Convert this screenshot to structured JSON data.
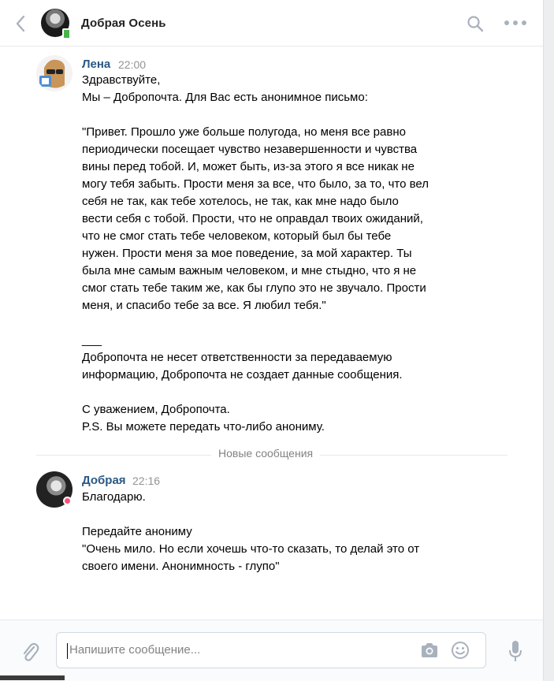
{
  "header": {
    "title": "Добрая Осень"
  },
  "messages": [
    {
      "author": "Лена",
      "time": "22:00",
      "text": "Здравствуйте,\nМы – Добропочта. Для Вас есть анонимное письмо:\n\n\"Привет. Прошло уже больше полугода, но меня все равно\nпериодически посещает чувство незавершенности и чувства\nвины перед тобой. И, может быть, из-за этого я все никак не\nмогу тебя забыть. Прости меня за все, что было, за то, что вел\nсебя не так, как тебе хотелось, не так, как мне надо было\nвести себя с тобой. Прости, что не оправдал твоих ожиданий,\nчто не смог стать тебе человеком, который был бы тебе\nнужен. Прости меня за мое поведение, за мой характер. Ты\nбыла мне самым важным человеком, и мне стыдно, что я не\nсмог стать тебе таким же, как бы глупо это не звучало. Прости\nменя, и спасибо тебе за все. Я любил тебя.\"\n\n___\nДобропочта не несет ответственности за передаваемую\nинформацию, Добропочта не создает данные сообщения.\n\nС уважением, Добропочта.\nP.S. Вы можете передать что-либо анониму."
    },
    {
      "author": "Добрая",
      "time": "22:16",
      "text": "Благодарю.\n\nПередайте анониму\n\"Очень мило. Но если хочешь что-то сказать, то делай это от\nсвоего имени. Анонимность - глупо\""
    }
  ],
  "divider": {
    "label": "Новые сообщения"
  },
  "composer": {
    "placeholder": "Напишите сообщение..."
  },
  "colors": {
    "author_link": "#2a5885",
    "icon_gray": "#a8b2bd",
    "online": "#ff4f7a",
    "mobile_online": "#4bb34b"
  },
  "icons": [
    "back-arrow-icon",
    "search-icon",
    "more-icon",
    "paperclip-icon",
    "camera-icon",
    "smile-icon",
    "microphone-icon"
  ]
}
